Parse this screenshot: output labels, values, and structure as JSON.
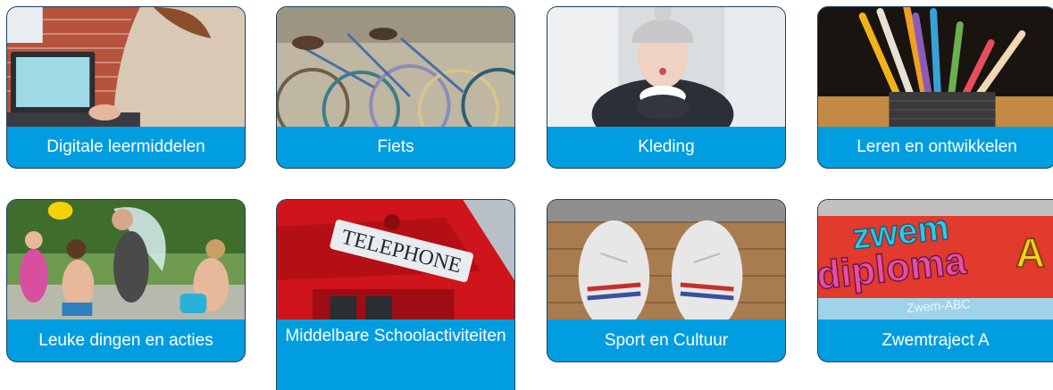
{
  "tiles": [
    {
      "label": "Digitale leermiddelen",
      "image": "person-with-laptop"
    },
    {
      "label": "Fiets",
      "image": "bicycles"
    },
    {
      "label": "Kleding",
      "image": "girl-blowing-snow"
    },
    {
      "label": "Leren en ontwikkelen",
      "image": "pencils-in-holder"
    },
    {
      "label": "Leuke dingen en acties",
      "image": "children-water-play"
    },
    {
      "label": "Middelbare Schoolactiviteiten",
      "image": "telephone-booth"
    },
    {
      "label": "Sport en Cultuur",
      "image": "sneakers-on-floor"
    },
    {
      "label": "Zwemtraject A",
      "image": "swim-diploma-book"
    }
  ],
  "photo_text": {
    "telephone_sign": "TELEPHONE",
    "swim_line1": "zwem",
    "swim_line2": "diploma",
    "swim_letter": "A",
    "swim_sub": "Zwem-ABC"
  },
  "colors": {
    "tile_label_bg": "#009ee0",
    "tile_border": "#1f3f59",
    "label_text": "#ffffff"
  }
}
